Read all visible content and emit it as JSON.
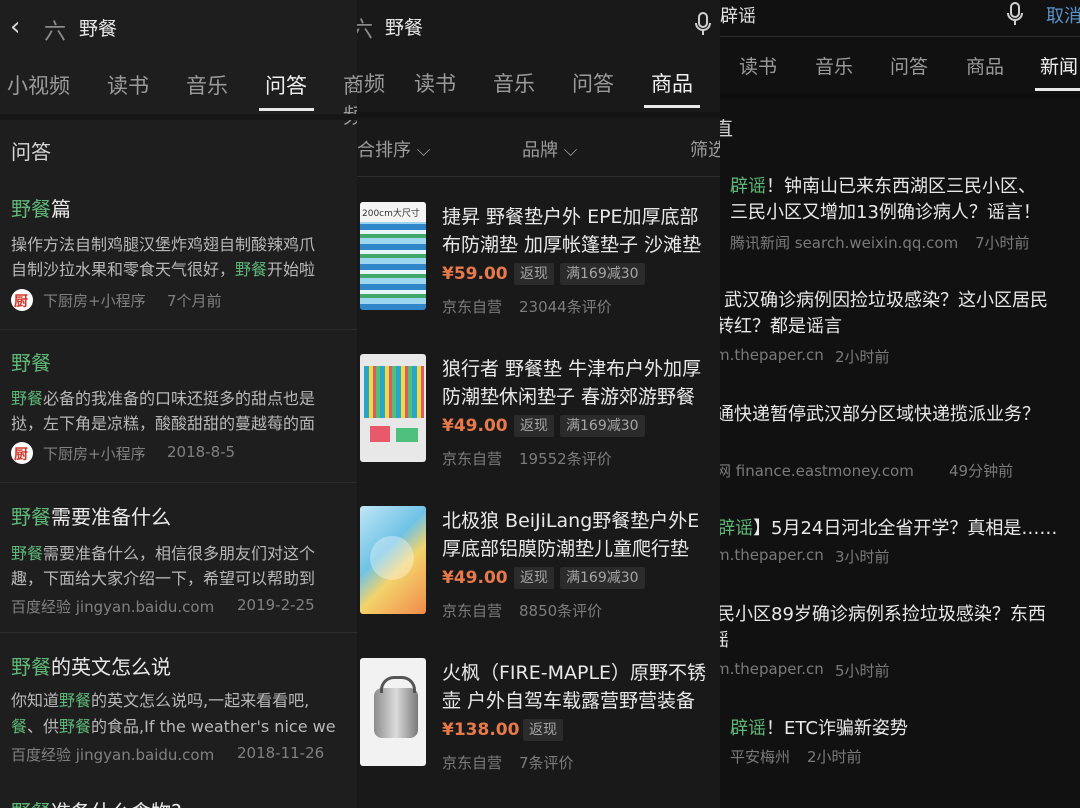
{
  "panel1": {
    "search": {
      "query": "野餐"
    },
    "tabs": [
      "小视频",
      "读书",
      "音乐",
      "问答",
      "商频"
    ],
    "section_title": "问答",
    "results": [
      {
        "title_hl": "野餐",
        "title_rest": "篇",
        "desc1": "操作方法自制鸡腿汉堡炸鸡翅自制酸辣鸡爪",
        "desc2_a": "自制沙拉水果和零食天气很好，",
        "desc2_hl": "野餐",
        "desc2_b": "开始啦",
        "source": "下厨房+小程序",
        "time": "7个月前"
      },
      {
        "title_hl": "野餐",
        "title_rest": "",
        "desc1_hl": "野餐",
        "desc1_rest": "必备的我准备的口味还挺多的甜点也是",
        "desc2": "挞，左下角是凉糕，酸酸甜甜的蔓越莓的面",
        "source": "下厨房+小程序",
        "time": "2018-8-5"
      },
      {
        "title_hl": "野餐",
        "title_rest": "需要准备什么",
        "desc1_hl": "野餐",
        "desc1_rest": "需要准备什么，相信很多朋友们对这个",
        "desc2": "趣，下面给大家介绍一下，希望可以帮助到",
        "source": "百度经验 jingyan.baidu.com",
        "time": "2019-2-25"
      },
      {
        "title_hl": "野餐",
        "title_rest": "的英文怎么说",
        "desc1_a": "你知道",
        "desc1_hl": "野餐",
        "desc1_b": "的英文怎么说吗,一起来看看吧,",
        "desc2_hl1": "餐",
        "desc2_a": "、供",
        "desc2_hl2": "野餐",
        "desc2_b": "的食品,If the weather's nice we",
        "source": "百度经验 jingyan.baidu.com",
        "time": "2018-11-26"
      },
      {
        "title_hl": "野餐",
        "title_rest": "准备什么食物?"
      }
    ],
    "chef_glyph": "厨"
  },
  "panel2": {
    "search": {
      "query": "野餐"
    },
    "tabs": [
      "商频",
      "读书",
      "音乐",
      "问答",
      "商品"
    ],
    "filters": [
      "合排序",
      "品牌",
      "筛选"
    ],
    "products": [
      {
        "line1": "捷昇 野餐垫户外 EPE加厚底部",
        "line2": "布防潮垫 加厚帐篷垫子 沙滩垫",
        "price": "¥59.00",
        "tags": [
          "返现",
          "满169减30"
        ],
        "shop": "京东自营",
        "reviews": "23044条评价",
        "thumb_label": "200cm大尺寸"
      },
      {
        "line1": "狼行者 野餐垫 牛津布户外加厚",
        "line2": "防潮垫休闲垫子 春游郊游野餐",
        "price": "¥49.00",
        "tags": [
          "返现",
          "满169减30"
        ],
        "shop": "京东自营",
        "reviews": "19552条评价"
      },
      {
        "line1": "北极狼 BeiJiLang野餐垫户外E",
        "line2": "厚底部铝膜防潮垫儿童爬行垫",
        "price": "¥49.00",
        "tags": [
          "返现",
          "满169减30"
        ],
        "shop": "京东自营",
        "reviews": "8850条评价"
      },
      {
        "line1": "火枫（FIRE-MAPLE）原野不锈",
        "line2": "壶 户外自驾车载露营野营装备",
        "price": "¥138.00",
        "tags": [
          "返现"
        ],
        "shop": "京东自营",
        "reviews": "7条评价"
      }
    ]
  },
  "panel3": {
    "search": {
      "query": "辟谣",
      "cancel": "取消"
    },
    "tabs": [
      "读书",
      "音乐",
      "问答",
      "商品",
      "新闻"
    ],
    "section_partial": "直",
    "news": [
      {
        "l1_hl": "辟谣",
        "l1_rest": "！钟南山已来东西湖区三民小区、",
        "l2": "三民小区又增加13例确诊病人？谣言！",
        "source": "腾讯新闻 search.weixin.qq.com",
        "time": "7小时前"
      },
      {
        "l1": "武汉确诊病例因捡垃圾感染？这小区居民",
        "l2": "转红？都是谣言",
        "source": "m.thepaper.cn",
        "time": "2小时前"
      },
      {
        "l1": "通快递暂停武汉部分区域快递揽派业务？",
        "source": "网 finance.eastmoney.com",
        "time": "49分钟前"
      },
      {
        "l1_hl": "辟谣",
        "l1_rest": "】5月24日河北全省开学？真相是……",
        "source": "m.thepaper.cn",
        "time": "3小时前"
      },
      {
        "l1": "民小区89岁确诊病例系捡垃圾感染？东西",
        "l2_hl": "谣",
        "source": "m.thepaper.cn",
        "time": "5小时前"
      },
      {
        "l1_hl": "辟谣",
        "l1_rest": "！ETC诈骗新姿势",
        "source": "平安梅州",
        "time": "2小时前"
      }
    ]
  }
}
